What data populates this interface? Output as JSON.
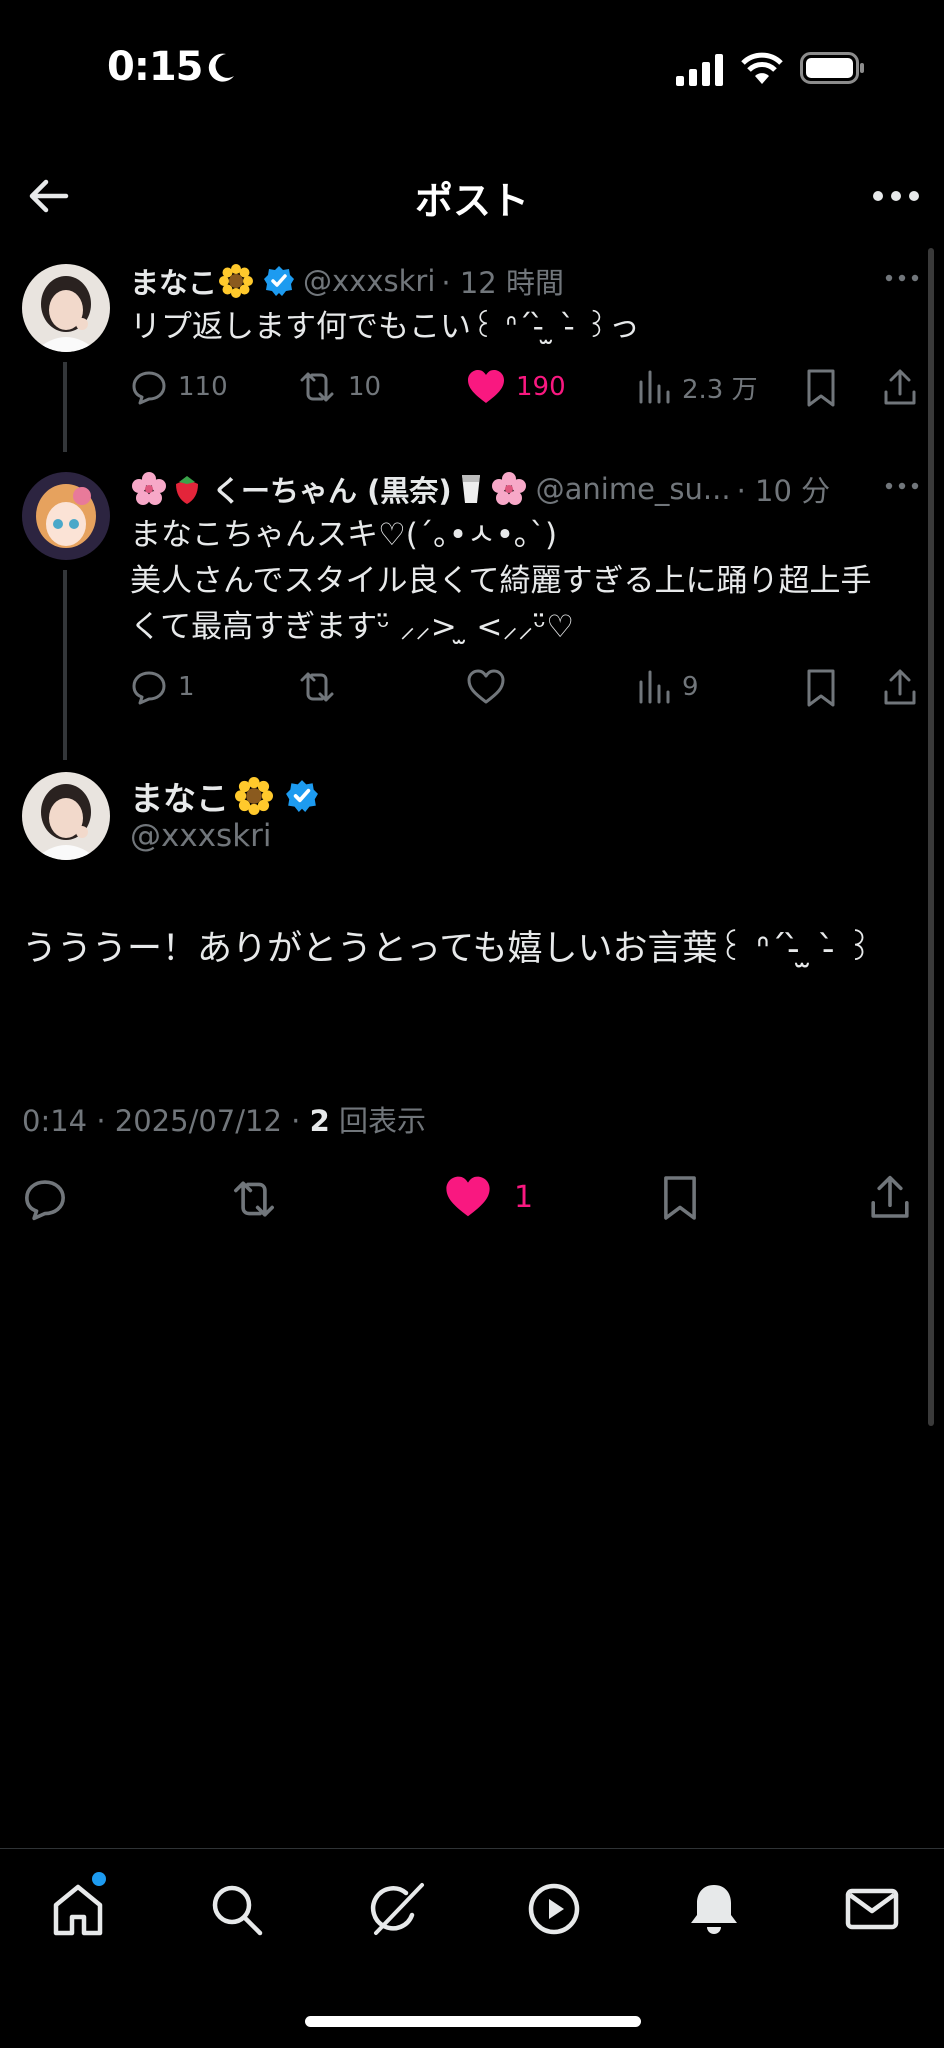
{
  "status_bar": {
    "time": "0:15"
  },
  "header": {
    "title": "ポスト"
  },
  "thread": [
    {
      "name": "まなこ",
      "handle": "@xxxskri",
      "time": "· 12 時間",
      "text": "リプ返します何でもこい꒰ ᐢ´-̀ ̫ -̀ ꒱っ",
      "replies": "110",
      "reposts": "10",
      "likes": "190",
      "views": "2.3 万"
    },
    {
      "name": "くーちゃん (黒奈)",
      "handle": "@anime_su...",
      "time": "· 10 分",
      "text": "まなこちゃんスキ♡(´｡•ㅅ•｡`)\n美人さんでスタイル良くて綺麗すぎる上に踊り超上手くて最高すぎますᵕ̈ ⸝⸝> ̫ <⸝⸝ᵕ̈♡",
      "replies": "1",
      "views": "9"
    }
  ],
  "main_post": {
    "name": "まなこ",
    "handle": "@xxxskri",
    "text": "うううー！ありがとうとっても嬉しいお言葉꒰ ᐢ´-̀ ̫ -̀ ꒱",
    "time_prefix": "0:14 · 2025/07/12 · ",
    "view_count": "2",
    "view_suffix": " 回表示",
    "likes": "1"
  },
  "colors": {
    "like": "#f91880",
    "verified": "#1d9bf0",
    "muted": "#71767b"
  }
}
